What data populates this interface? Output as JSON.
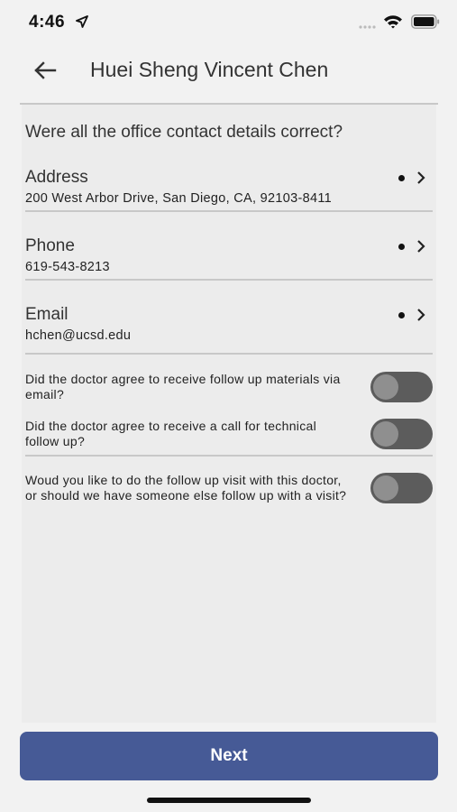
{
  "status_bar": {
    "time": "4:46"
  },
  "header": {
    "title": "Huei Sheng Vincent Chen"
  },
  "question": "Were all the office contact details correct?",
  "contacts": [
    {
      "label": "Address",
      "value": "200 West Arbor Drive, San Diego, CA, 92103-8411"
    },
    {
      "label": "Phone",
      "value": "619-543-8213"
    },
    {
      "label": "Email",
      "value": "hchen@ucsd.edu"
    }
  ],
  "toggles": [
    {
      "text": "Did the doctor agree to receive follow up materials via email?",
      "on": false
    },
    {
      "text": "Did the doctor agree to receive a call for technical follow up?",
      "on": false
    },
    {
      "text": "Woud you like to do the follow up visit with this doctor, or should we have someone else follow up with a visit?",
      "on": false
    }
  ],
  "footer": {
    "next_label": "Next"
  },
  "colors": {
    "primary": "#465a96",
    "background": "#f2f2f2",
    "toggle_off": "#5c5c5c"
  },
  "icons": [
    "location-arrow-icon",
    "signal-icon",
    "wifi-icon",
    "battery-icon",
    "back-arrow-icon",
    "dot-icon",
    "chevron-right-icon"
  ]
}
